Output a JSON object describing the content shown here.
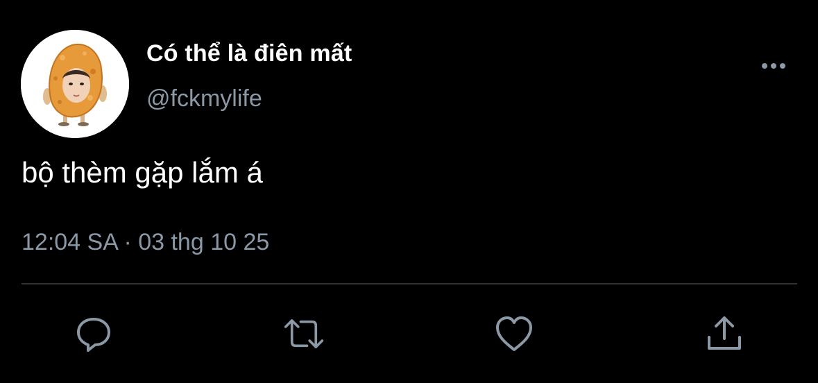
{
  "user": {
    "display_name": "Có thể là điên mất",
    "handle": "@fckmylife",
    "avatar_icon": "fried-nugget-avatar-icon"
  },
  "tweet": {
    "text": "bộ thèm gặp lắm á",
    "timestamp": "12:04 SA · 03 thg 10 25"
  },
  "menu": {
    "icon": "more-horizontal-icon"
  },
  "actions": [
    {
      "icon": "reply-icon"
    },
    {
      "icon": "retweet-icon"
    },
    {
      "icon": "like-icon"
    },
    {
      "icon": "share-icon"
    }
  ],
  "colors": {
    "background": "#000000",
    "primary_text": "#ffffff",
    "secondary_text": "#8b98a5",
    "divider": "#2f3336",
    "icon": "#8b98a5"
  }
}
